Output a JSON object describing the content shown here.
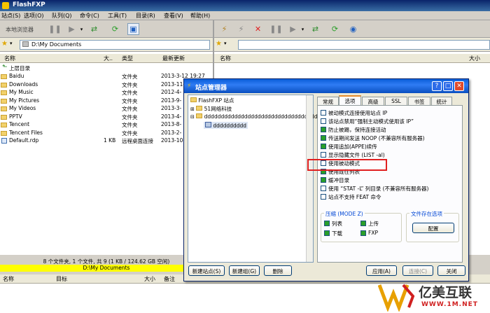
{
  "app": {
    "title": "FlashFXP"
  },
  "menu": [
    "站点(S)",
    "选项(O)",
    "队列(Q)",
    "命令(C)",
    "工具(T)",
    "目录(R)",
    "查看(V)",
    "帮助(H)"
  ],
  "toolbar": {
    "local_browser": "本地浏览器"
  },
  "local": {
    "path": "D:\\My Documents",
    "columns": {
      "name": "名称",
      "size": "大..",
      "type": "类型",
      "modified": "最新更新"
    },
    "files": [
      {
        "name": "上层目录",
        "size": "",
        "type": "",
        "modified": ""
      },
      {
        "name": "Baidu",
        "size": "",
        "type": "文件夹",
        "modified": "2013-3-12 19:27"
      },
      {
        "name": "Downloads",
        "size": "",
        "type": "文件夹",
        "modified": "2013-11-"
      },
      {
        "name": "My Music",
        "size": "",
        "type": "文件夹",
        "modified": "2012-4-"
      },
      {
        "name": "My Pictures",
        "size": "",
        "type": "文件夹",
        "modified": "2013-9-"
      },
      {
        "name": "My Videos",
        "size": "",
        "type": "文件夹",
        "modified": "2013-3-"
      },
      {
        "name": "PPTV",
        "size": "",
        "type": "文件夹",
        "modified": "2013-4-"
      },
      {
        "name": "Tencent",
        "size": "",
        "type": "文件夹",
        "modified": "2013-8-"
      },
      {
        "name": "Tencent Files",
        "size": "",
        "type": "文件夹",
        "modified": "2013-2-"
      },
      {
        "name": "Default.rdp",
        "size": "1 KB",
        "type": "远程桌面连接",
        "modified": "2013-10-"
      }
    ],
    "status": "8 个文件夹, 1 个文件, 共 9 (1 KB / 124.62 GB 空闲)",
    "status_path": "D:\\My Documents"
  },
  "remote": {
    "columns": {
      "name": "名称",
      "size": "大小"
    }
  },
  "queue": {
    "columns": {
      "name": "名称",
      "target": "目标",
      "size": "大小",
      "note": "备注"
    }
  },
  "dialog": {
    "title": "站点管理器",
    "tree": [
      "FlashFXP 站点",
      "51网络科技",
      "dddddddddddddddddddddddddddddddddd",
      "dddddddddd"
    ],
    "tabs": [
      "常规",
      "选项",
      "高级",
      "SSL",
      "书签",
      "统计"
    ],
    "options": [
      {
        "label": "被动模式连接使用站点 IP",
        "checked": false
      },
      {
        "label": "该站点禁用“强制主动模式使用该 IP”",
        "checked": false
      },
      {
        "label": "防止被踢，保持连接活动",
        "checked": true
      },
      {
        "label": "传送期间发送 NOOP (不兼容所有服务器)",
        "checked": true
      },
      {
        "label": "使用追加(APPE)续传",
        "checked": true
      },
      {
        "label": "显示隐藏文件 (LIST -al)",
        "checked": false
      },
      {
        "label": "使用被动模式",
        "checked": false
      },
      {
        "label": "使用既往列表",
        "checked": true
      },
      {
        "label": "缓冲目录",
        "checked": true
      },
      {
        "label": "使用 “STAT -L” 列目录 (不兼容所有服务器)",
        "checked": false
      },
      {
        "label": "站点不支持 FEAT 命令",
        "checked": false
      }
    ],
    "compress": {
      "title": "压缩 (MODE Z)",
      "items": [
        {
          "label": "列表",
          "checked": true
        },
        {
          "label": "上传",
          "checked": true
        },
        {
          "label": "下载",
          "checked": true
        },
        {
          "label": "FXP",
          "checked": true
        }
      ]
    },
    "file_exists": {
      "title": "文件存在选项",
      "button": "配置"
    },
    "buttons": {
      "new_site": "新建站点(S)",
      "new_group": "新建组(G)",
      "delete": "删除",
      "apply": "应用(A)",
      "connect": "连接(C)",
      "close": "关闭"
    }
  },
  "watermark": {
    "brand": "亿美互联",
    "url": "WWW.1M.NET"
  }
}
